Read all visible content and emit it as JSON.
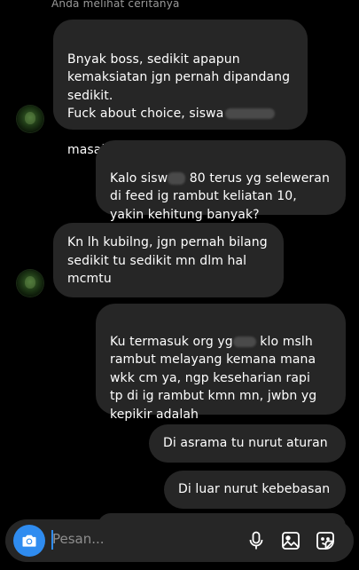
{
  "header": {
    "caption": "Anda melihat ceritanya"
  },
  "messages": [
    {
      "side": "in",
      "text": "Bnyak boss, sedikit apapun\nkemaksiatan jgn pernah dipandang\nsedikit.\nFuck about choice, siswa",
      "text_tail": "masalah e ne"
    },
    {
      "side": "out",
      "text_a": "Kalo sisw",
      "text_b": " 80 terus yg seleweran\ndi feed ig rambut keliatan 10,\nyakin kehitung banyak?"
    },
    {
      "side": "in",
      "text": "Kn lh kubilng, jgn pernah bilang\nsedikit tu sedikit mn dlm hal\nmcmtu"
    },
    {
      "side": "out",
      "text_a": "Ku termasuk org yg",
      "text_b": " klo mslh\nrambut melayang kemana mana\nwkk cm ya, ngp keseharian rapi\ntp di ig rambut kmn mn, jwbn yg\nkepikir adalah"
    },
    {
      "side": "out",
      "text": "Di asrama tu nurut aturan"
    },
    {
      "side": "out",
      "text": "Di luar nurut kebebasan"
    }
  ],
  "composer": {
    "placeholder": "Pesan...",
    "icons": [
      "camera-icon",
      "microphone-icon",
      "gallery-icon",
      "sticker-icon"
    ],
    "accent": "#2f8cf0"
  },
  "colors": {
    "background": "#000000",
    "bubble": "#262626",
    "text": "#ffffff"
  }
}
